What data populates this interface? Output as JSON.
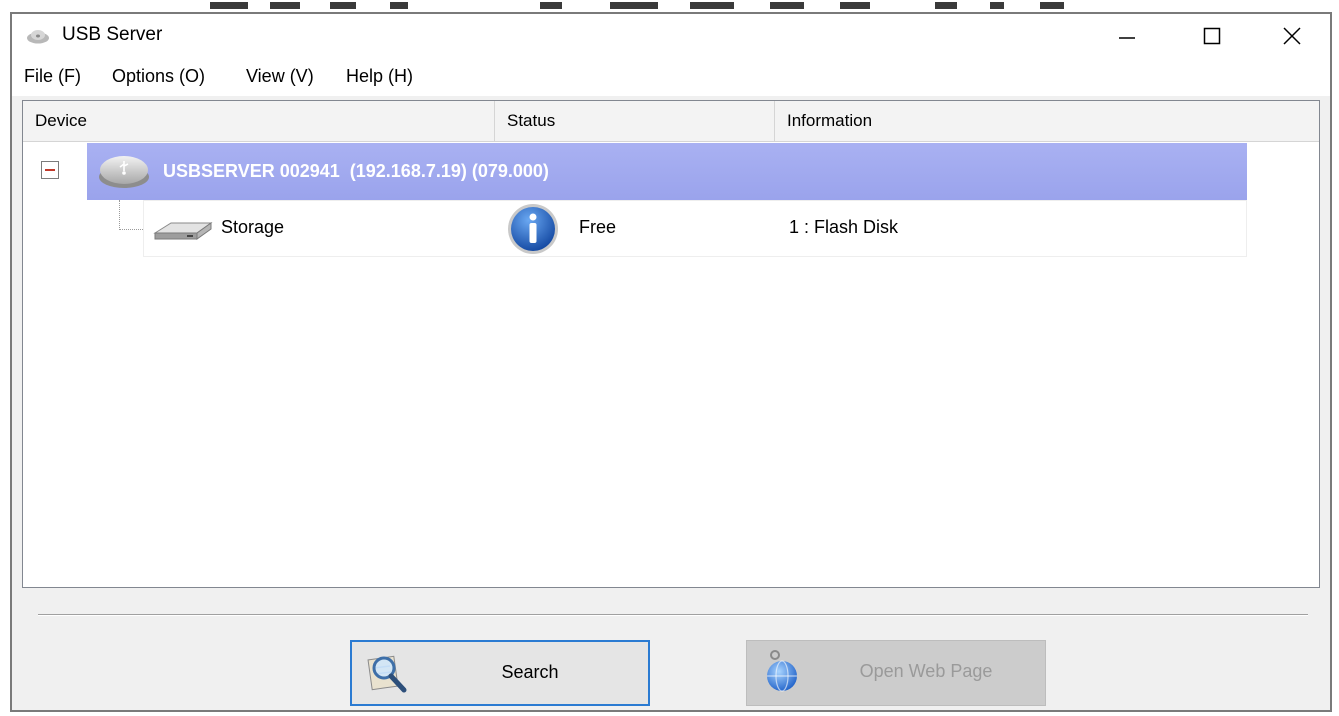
{
  "window": {
    "title": "USB Server"
  },
  "menu": [
    "File (F)",
    "Options (O)",
    "View (V)",
    "Help (H)"
  ],
  "columns": [
    "Device",
    "Status",
    "Information"
  ],
  "server": {
    "label": "USBSERVER 002941  (192.168.7.19) (079.000)",
    "highlight_color": "#a3abef"
  },
  "device": {
    "name": "Storage",
    "status": "Free",
    "information": "1 : Flash Disk"
  },
  "buttons": {
    "search": "Search",
    "open_web": "Open Web Page"
  },
  "icons": {
    "app": "usb-cloud-icon",
    "server": "usb-server-icon",
    "storage": "hard-disk-icon",
    "status": "info-icon",
    "search": "magnifier-icon",
    "web": "globe-icon"
  }
}
